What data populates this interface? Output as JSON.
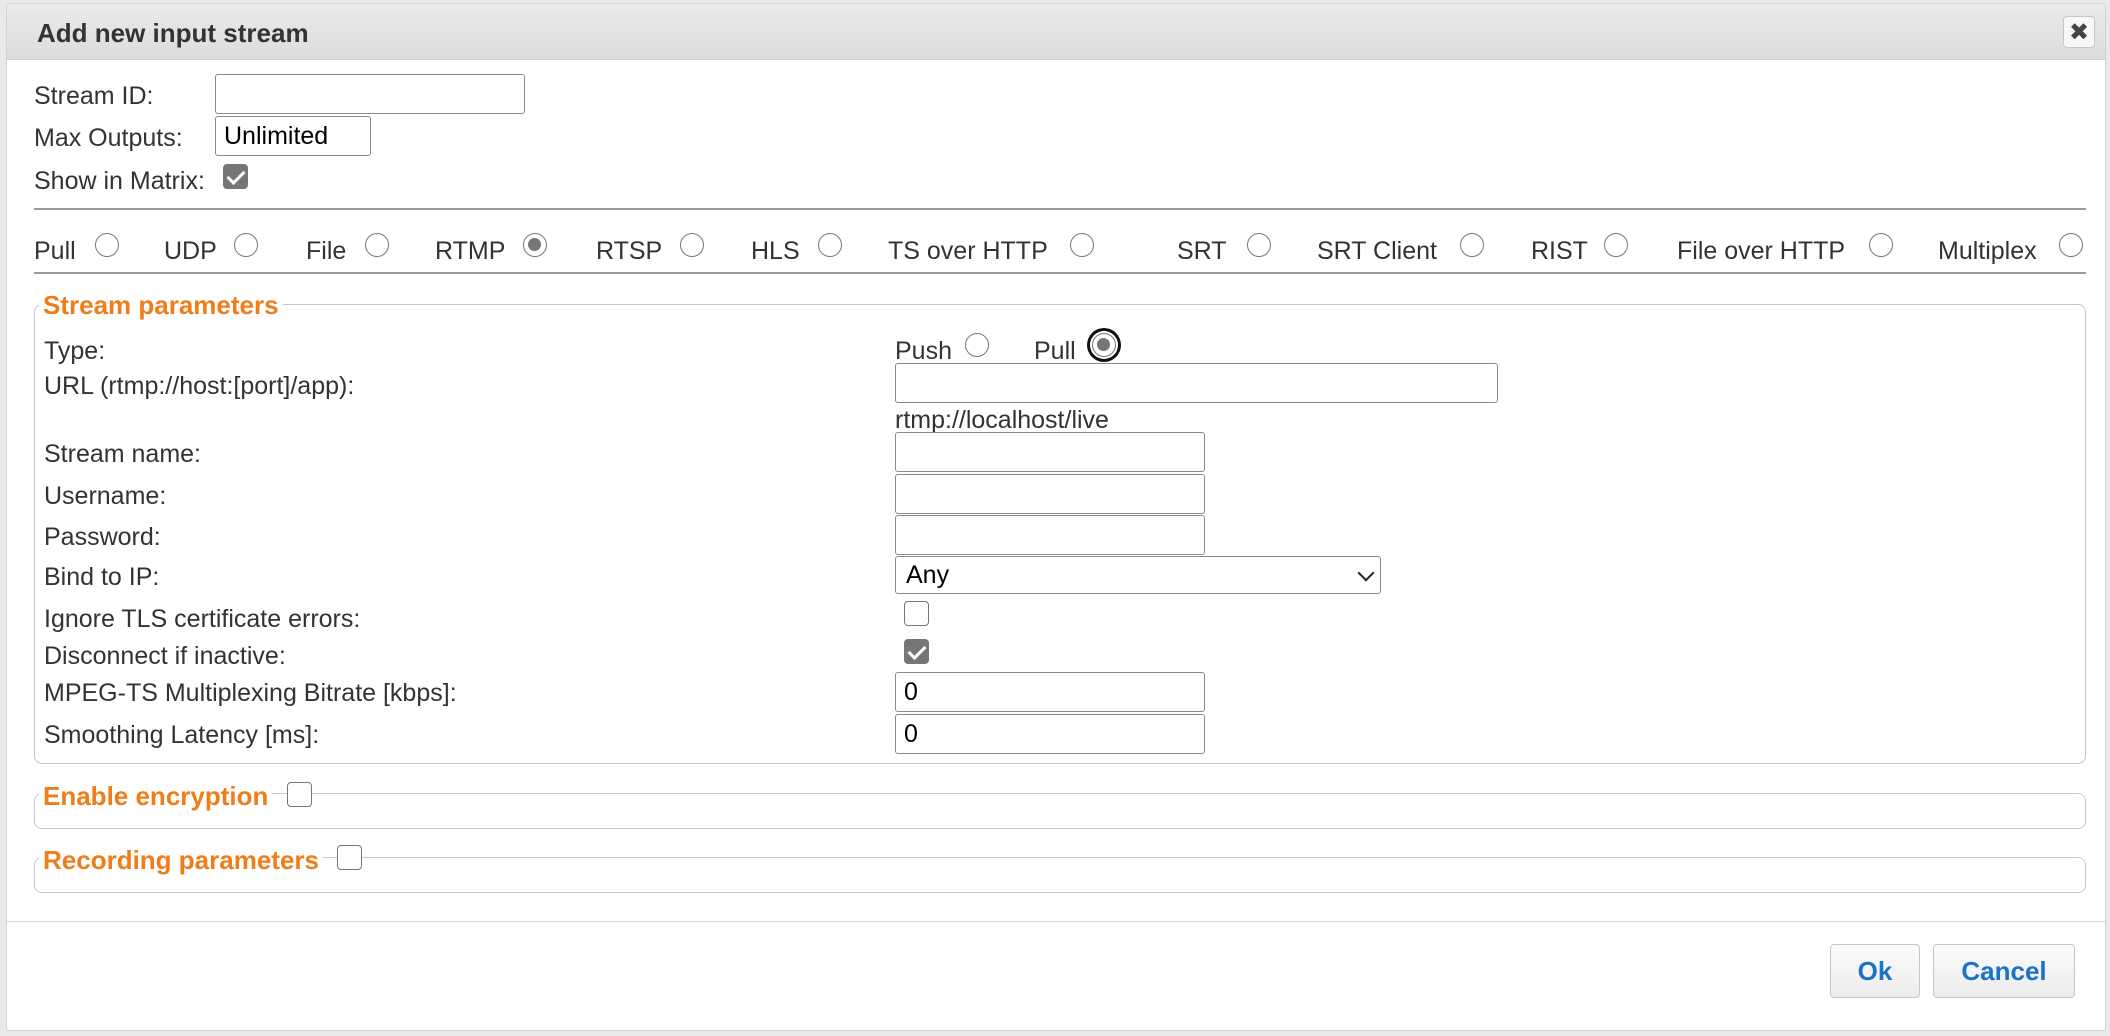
{
  "dialog": {
    "title": "Add new input stream",
    "close_icon": "close-icon"
  },
  "general": {
    "stream_id_label": "Stream ID:",
    "stream_id_value": "",
    "max_outputs_label": "Max Outputs:",
    "max_outputs_value": "Unlimited",
    "show_in_matrix_label": "Show in Matrix:",
    "show_in_matrix_checked": true
  },
  "stream_types": {
    "selected": "RTMP",
    "options": [
      "Pull",
      "UDP",
      "File",
      "RTMP",
      "RTSP",
      "HLS",
      "TS over HTTP",
      "SRT",
      "SRT Client",
      "RIST",
      "File over HTTP",
      "Multiplex"
    ]
  },
  "stream_parameters": {
    "legend": "Stream parameters",
    "type_label": "Type:",
    "type_push": "Push",
    "type_pull": "Pull",
    "type_selected": "Pull",
    "url_label": "URL (rtmp://host:[port]/app):",
    "url_value": "",
    "url_hint": "rtmp://localhost/live",
    "stream_name_label": "Stream name:",
    "username_label": "Username:",
    "password_label": "Password:",
    "bind_ip_label": "Bind to IP:",
    "bind_ip_value": "Any",
    "ignore_tls_label": "Ignore TLS certificate errors:",
    "ignore_tls_checked": false,
    "disconnect_label": "Disconnect if inactive:",
    "disconnect_checked": true,
    "mpegts_label": "MPEG-TS Multiplexing Bitrate [kbps]:",
    "mpegts_value": "0",
    "smoothing_label": "Smoothing Latency [ms]:",
    "smoothing_value": "0"
  },
  "encryption": {
    "legend": "Enable encryption",
    "checked": false
  },
  "recording": {
    "legend": "Recording parameters",
    "checked": false
  },
  "footer": {
    "ok_label": "Ok",
    "cancel_label": "Cancel"
  },
  "colors": {
    "legend": "#ef7d1a",
    "button_text": "#1a73c8"
  }
}
